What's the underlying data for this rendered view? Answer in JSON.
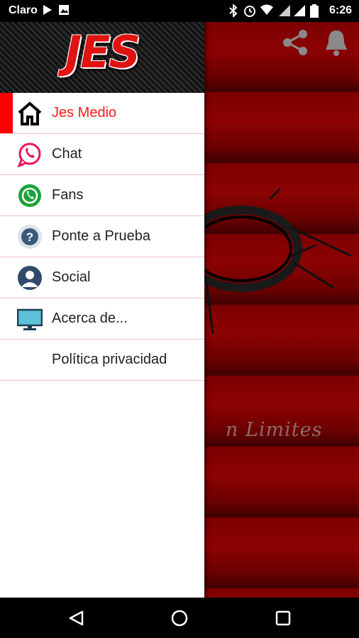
{
  "status_bar": {
    "carrier": "Claro",
    "time": "6:26"
  },
  "app_bar": {
    "share_icon": "share-icon",
    "bell_icon": "bell-icon"
  },
  "background": {
    "subtitle": "n Limites"
  },
  "drawer": {
    "logo": "JES",
    "items": [
      {
        "label": "Jes Medio",
        "icon": "home-icon",
        "active": true
      },
      {
        "label": "Chat",
        "icon": "chat-bubble-icon",
        "active": false
      },
      {
        "label": "Fans",
        "icon": "phone-bubble-icon",
        "active": false
      },
      {
        "label": "Ponte a Prueba",
        "icon": "question-icon",
        "active": false
      },
      {
        "label": "Social",
        "icon": "user-icon",
        "active": false
      },
      {
        "label": "Acerca de...",
        "icon": "monitor-icon",
        "active": false
      },
      {
        "label": "Política privacidad",
        "icon": "",
        "active": false
      }
    ]
  },
  "colors": {
    "accent": "#ff1a1a",
    "divider": "#f1c3c3",
    "background_red": "#7d0000"
  }
}
